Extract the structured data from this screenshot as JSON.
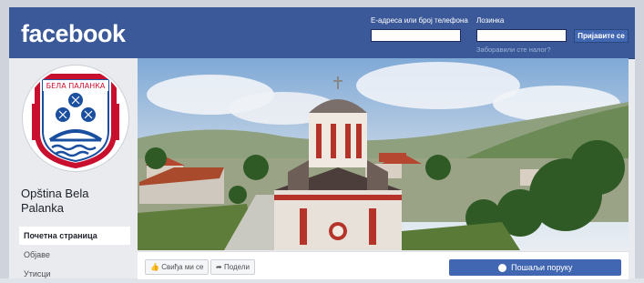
{
  "topbar": {
    "logo": "facebook",
    "email_label": "Е-адреса или број телефона",
    "password_label": "Лозинка",
    "login_button": "Пријавите се",
    "forgot_link": "Заборавили сте налог?"
  },
  "sidebar": {
    "page_name": "Opština Bela Palanka",
    "logo_text": "БЕЛА ПАЛАНКА",
    "nav": [
      {
        "label": "Почетна страница",
        "active": true
      },
      {
        "label": "Објаве",
        "active": false
      },
      {
        "label": "Утисци",
        "active": false
      }
    ]
  },
  "actions": {
    "like_label": "Свиђа ми се",
    "share_label": "Подели",
    "message_label": "Пошаљи поруку"
  },
  "colors": {
    "brand": "#3b5998",
    "button": "#4267b2"
  }
}
